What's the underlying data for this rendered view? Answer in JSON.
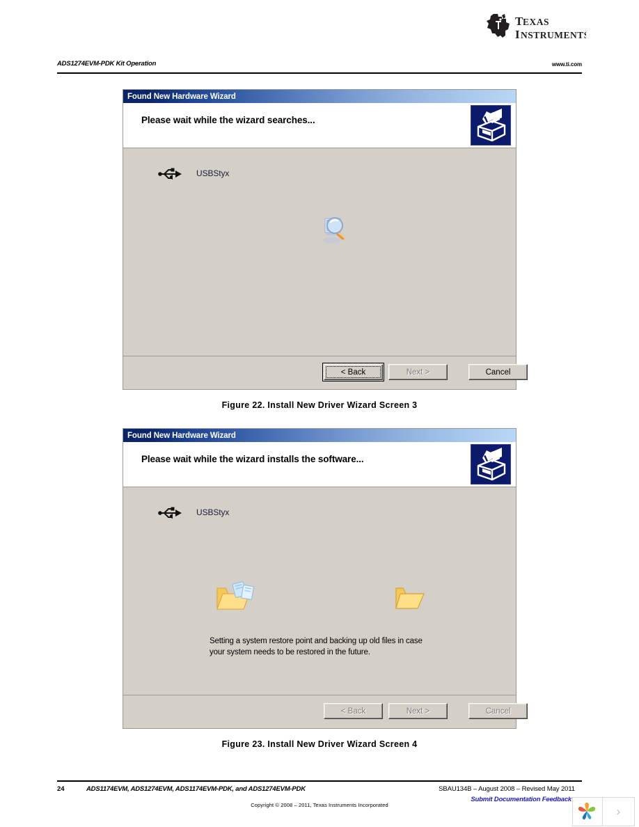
{
  "brand": {
    "logo_name": "texas-instruments-logo",
    "line1": "TEXAS",
    "line2": "INSTRUMENTS"
  },
  "header": {
    "document_section": "ADS1274EVM-PDK Kit Operation",
    "website": "www.ti.com"
  },
  "dialogs": [
    {
      "id": "wizard-screen-3",
      "title": "Found New Hardware Wizard",
      "heading": "Please wait while the wizard searches...",
      "badge_icon": "add-hardware-wizard-icon",
      "device": {
        "icon": "usb-icon",
        "label": "USBStyx"
      },
      "status_icon": "search-magnifier-icon",
      "status_text": "",
      "buttons": [
        {
          "label": "< Back",
          "mnemonic": "B",
          "state": "default-focus"
        },
        {
          "label": "Next >",
          "mnemonic": "N",
          "state": "disabled"
        },
        {
          "label": "Cancel",
          "mnemonic": "",
          "state": "enabled"
        }
      ]
    },
    {
      "id": "wizard-screen-4",
      "title": "Found New Hardware Wizard",
      "heading": "Please wait while the wizard installs the software...",
      "badge_icon": "add-hardware-wizard-icon",
      "device": {
        "icon": "usb-icon",
        "label": "USBStyx"
      },
      "status_icon_left": "folder-copy-files-icon",
      "status_icon_right": "open-folder-icon",
      "status_text": "Setting a system restore point and backing up old files in case your system needs to be restored in the future.",
      "buttons": [
        {
          "label": "< Back",
          "mnemonic": "B",
          "state": "disabled"
        },
        {
          "label": "Next >",
          "mnemonic": "N",
          "state": "disabled"
        },
        {
          "label": "Cancel",
          "mnemonic": "",
          "state": "disabled"
        }
      ]
    }
  ],
  "captions": [
    "Figure 22. Install New Driver Wizard Screen 3",
    "Figure 23. Install New Driver Wizard Screen 4"
  ],
  "footer": {
    "page_number": "24",
    "doc_list": "ADS1174EVM, ADS1274EVM, ADS1174EVM-PDK, and ADS1274EVM-PDK",
    "doc_id_line": "SBAU134B  – August 2008  – Revised May 2011",
    "feedback_link": "Submit Documentation Feedback",
    "copyright": "Copyright  © 2008  – 2011, Texas Instruments Incorporated",
    "corner_logo_name": "ti-pinwheel-logo",
    "corner_next_glyph": "›"
  },
  "colors": {
    "titlebar_start": "#0a246a",
    "titlebar_end": "#b9d6f5",
    "dialog_face": "#d4d0c8",
    "dialog_header_bg": "#ffffff",
    "link_blue": "#1c1ccc",
    "badge_navy": "#0b1a6b"
  }
}
